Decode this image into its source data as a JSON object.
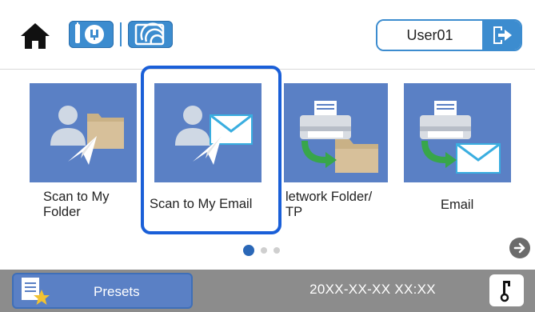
{
  "header": {
    "user_name": "User01"
  },
  "icons": {
    "home": "home-icon",
    "network": "ethernet-icon",
    "wifi": "wifi-icon",
    "logout": "logout-icon",
    "next": "arrow-right-icon",
    "presets": "presets-icon",
    "key": "key-icon"
  },
  "tiles": [
    {
      "label_lines": [
        "Scan to My",
        "Folder"
      ],
      "icon": "user-folder-icon"
    },
    {
      "label_lines": [
        "Scan to My Email"
      ],
      "icon": "user-email-icon",
      "selected": true
    },
    {
      "label_lines": [
        "letwork Folder/",
        "TP"
      ],
      "icon": "printer-folder-icon"
    },
    {
      "label_lines": [
        "Email"
      ],
      "icon": "printer-email-icon"
    }
  ],
  "pagination": {
    "current": 1,
    "total": 3
  },
  "footer": {
    "presets_label": "Presets",
    "datetime": "20XX-XX-XX XX:XX"
  },
  "colors": {
    "accent": "#3c8ccf",
    "tile": "#5a80c5",
    "selection": "#1a5fd8",
    "footer": "#8c8c8c"
  }
}
